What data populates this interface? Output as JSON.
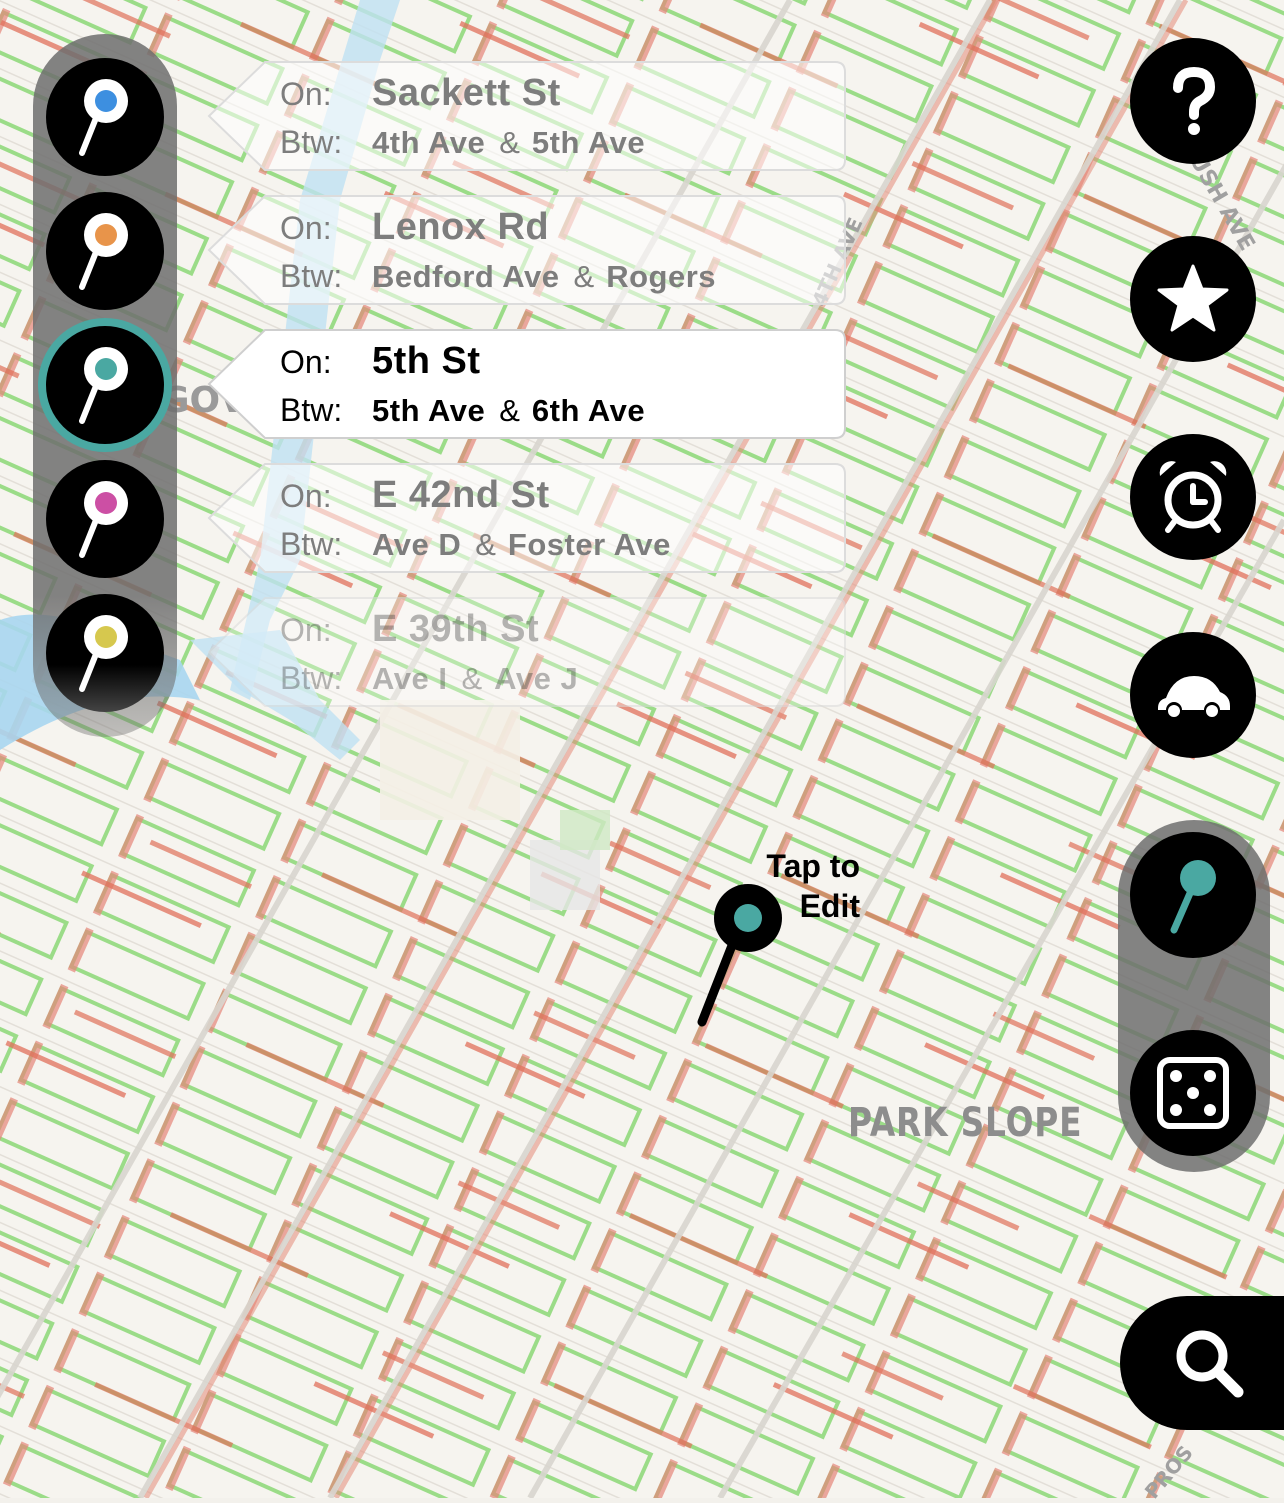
{
  "map": {
    "neighborhood": "PARK SLOPE",
    "street_labels": [
      "4TH AVE",
      "USH AVE",
      "PROS"
    ],
    "partial_label": "GOV",
    "edit_hint": [
      "Tap to",
      "Edit"
    ]
  },
  "pin_rail": {
    "pins": [
      {
        "color": "#3d8fe0"
      },
      {
        "color": "#e8944a"
      },
      {
        "color": "#4aa8a2",
        "selected": true
      },
      {
        "color": "#cc4fa4"
      },
      {
        "color": "#d6c84e"
      }
    ]
  },
  "callouts": [
    {
      "on_label": "On:",
      "btw_label": "Btw:",
      "street": "Sackett St",
      "from": "4th Ave",
      "amp": "&",
      "to": "5th Ave"
    },
    {
      "on_label": "On:",
      "btw_label": "Btw:",
      "street": "Lenox Rd",
      "from": "Bedford Ave",
      "amp": "&",
      "to": "Rogers"
    },
    {
      "on_label": "On:",
      "btw_label": "Btw:",
      "street": "5th St",
      "from": "5th Ave",
      "amp": "&",
      "to": "6th Ave"
    },
    {
      "on_label": "On:",
      "btw_label": "Btw:",
      "street": "E 42nd St",
      "from": "Ave D",
      "amp": "&",
      "to": "Foster Ave"
    },
    {
      "on_label": "On:",
      "btw_label": "Btw:",
      "street": "E 39th St",
      "from": "Ave I",
      "amp": "&",
      "to": "Ave J"
    }
  ],
  "right_buttons": [
    "help-icon",
    "star-icon",
    "alarm-clock-icon",
    "car-icon",
    "pin-icon",
    "dice-icon",
    "search-icon"
  ],
  "colors": {
    "accent": "#4aa8a2",
    "map_background": "#f3f1ec",
    "parking_ok": "#7fd06a",
    "parking_no": "#e0705a"
  }
}
